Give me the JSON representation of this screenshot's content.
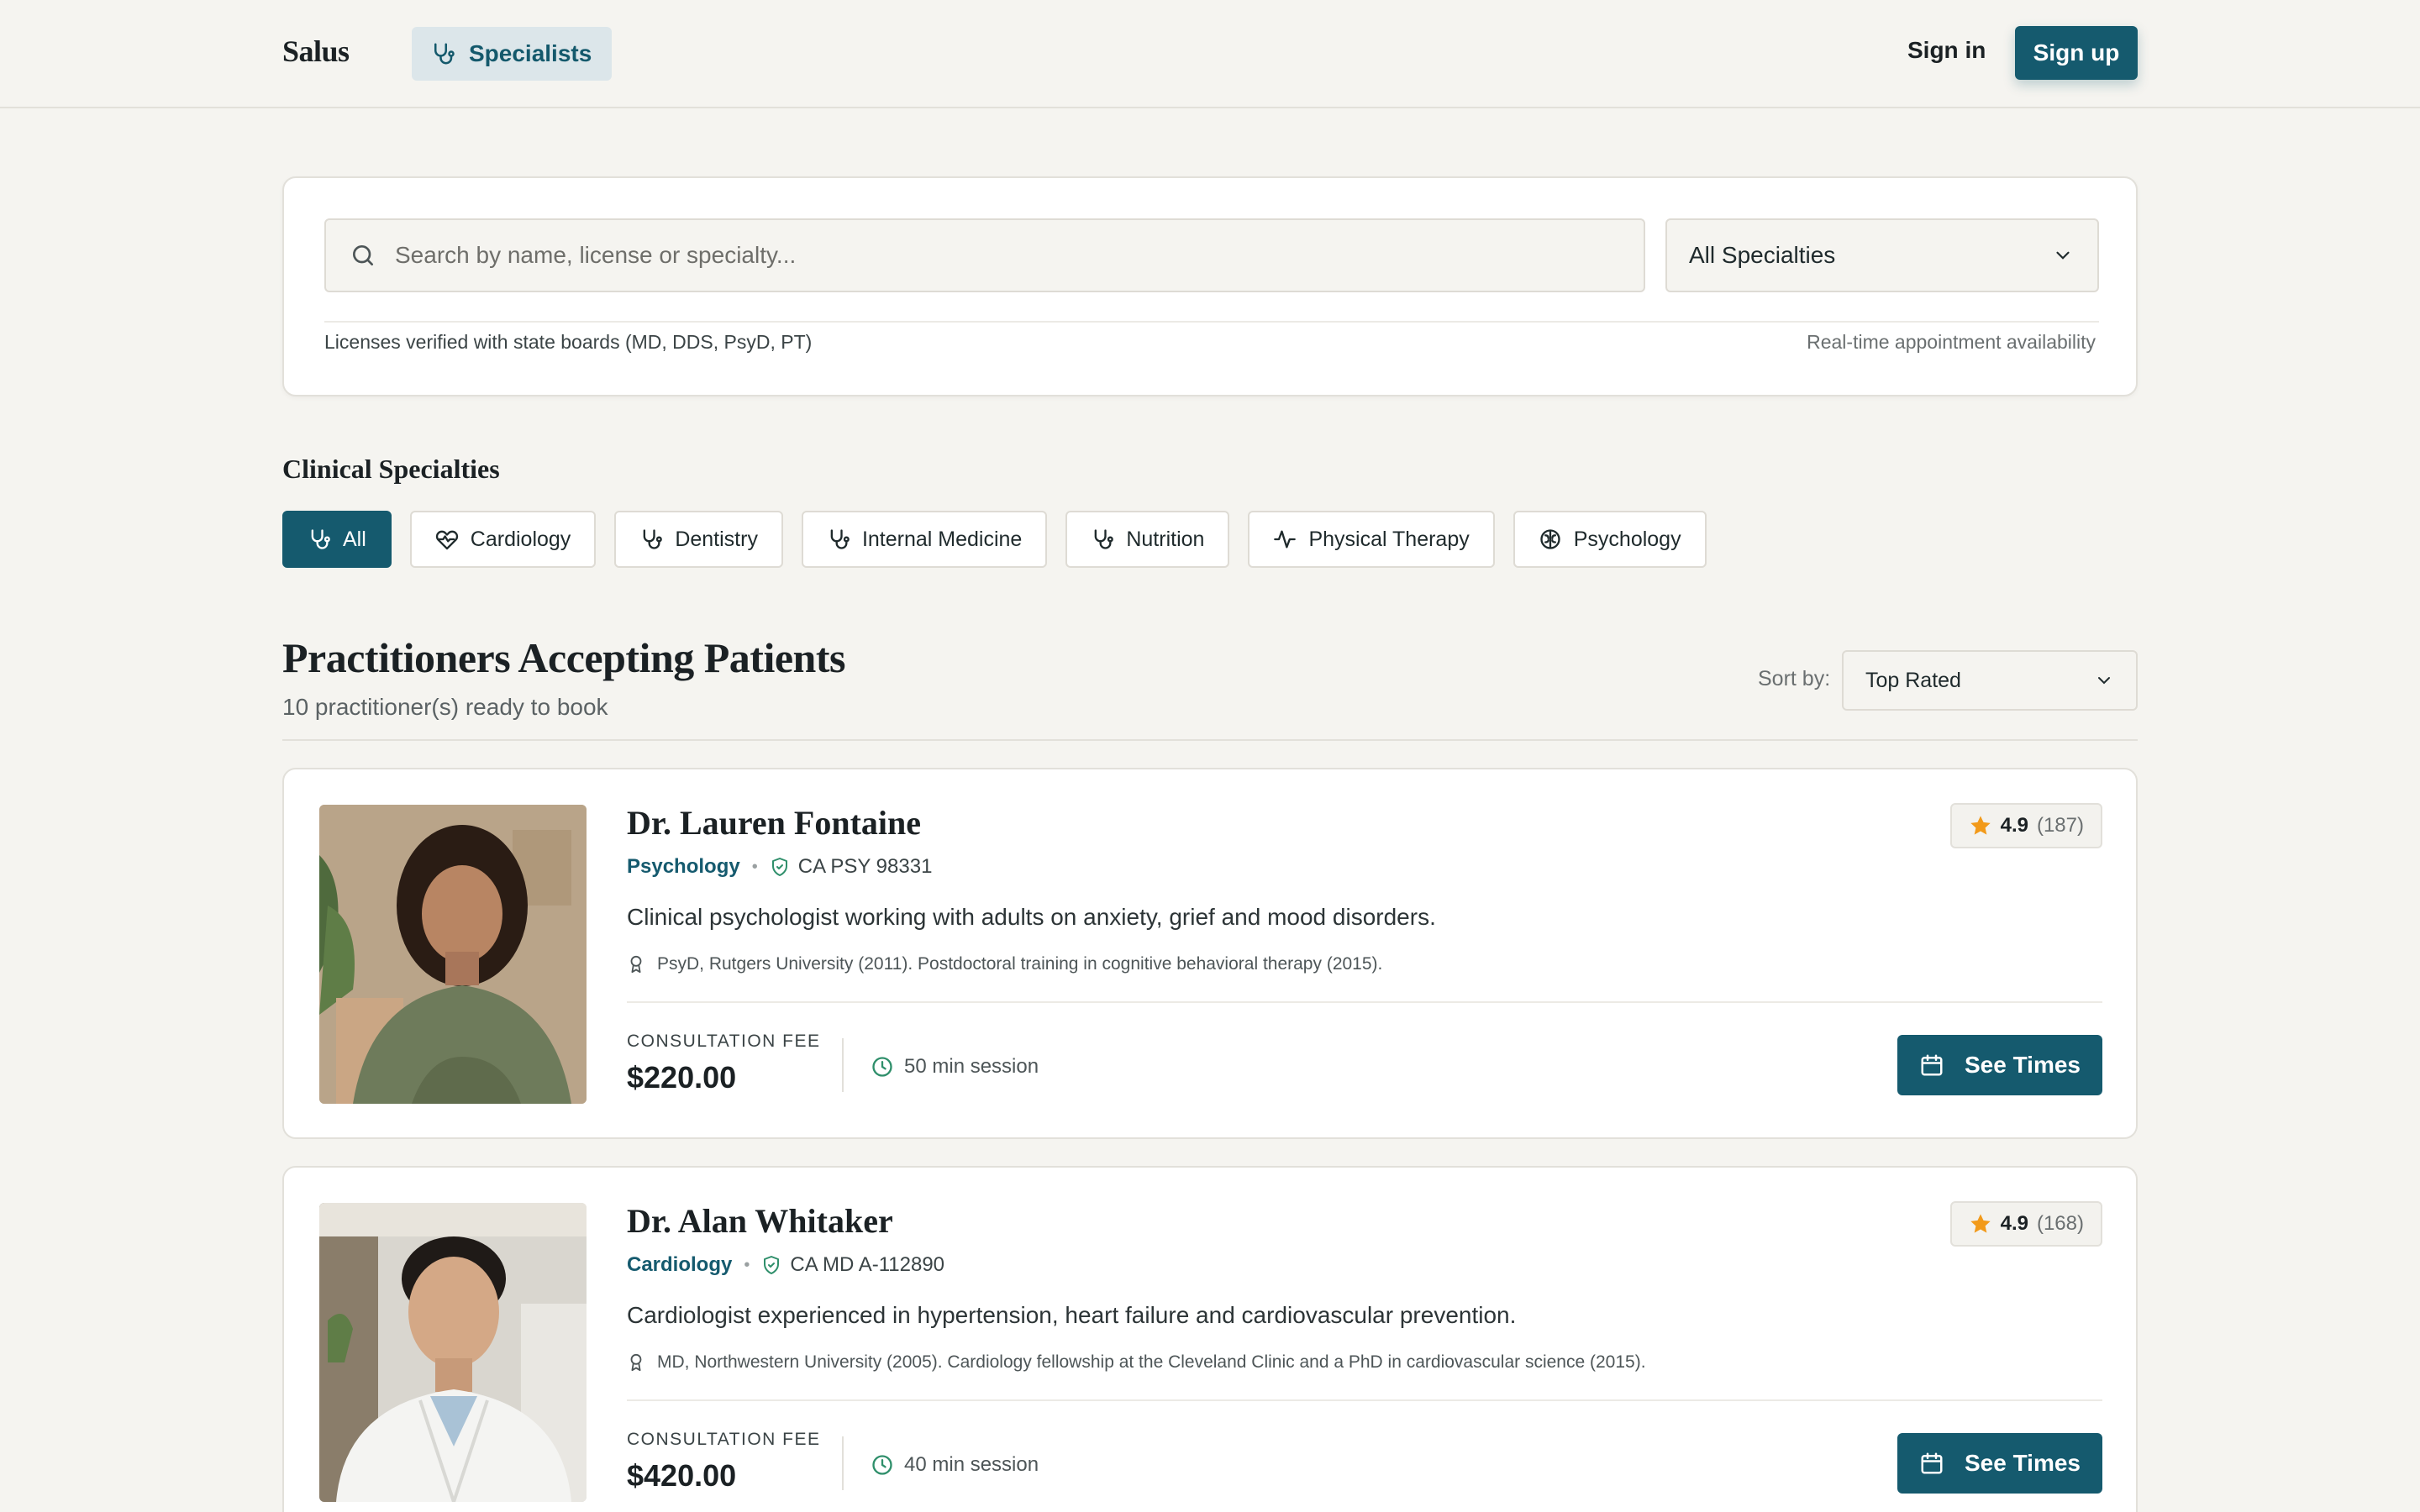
{
  "header": {
    "logo": "Salus",
    "nav_label": "Specialists",
    "signin_label": "Sign in",
    "signup_label": "Sign up"
  },
  "search": {
    "placeholder": "Search by name, license or specialty...",
    "specialty_selected": "All Specialties",
    "note_left": "Licenses verified with state boards (MD, DDS, PsyD, PT)",
    "note_right": "Real-time appointment availability"
  },
  "specialties": {
    "title": "Clinical Specialties",
    "chips": [
      {
        "label": "All",
        "icon": "stethoscope-icon",
        "active": true
      },
      {
        "label": "Cardiology",
        "icon": "heart-pulse-icon",
        "active": false
      },
      {
        "label": "Dentistry",
        "icon": "stethoscope-icon",
        "active": false
      },
      {
        "label": "Internal Medicine",
        "icon": "stethoscope-icon",
        "active": false
      },
      {
        "label": "Nutrition",
        "icon": "stethoscope-icon",
        "active": false
      },
      {
        "label": "Physical Therapy",
        "icon": "activity-icon",
        "active": false
      },
      {
        "label": "Psychology",
        "icon": "brain-icon",
        "active": false
      }
    ]
  },
  "results": {
    "title": "Practitioners Accepting Patients",
    "count_text": "10 practitioner(s) ready to book",
    "sort_label": "Sort by:",
    "sort_selected": "Top Rated"
  },
  "practitioners": [
    {
      "name": "Dr. Lauren Fontaine",
      "specialty": "Psychology",
      "license": "CA PSY 98331",
      "bio": "Clinical psychologist working with adults on anxiety, grief and mood disorders.",
      "education": "PsyD, Rutgers University (2011). Postdoctoral training in cognitive behavioral therapy (2015).",
      "fee_label": "CONSULTATION FEE",
      "fee": "$220.00",
      "session": "50 min session",
      "rating": "4.9",
      "reviews": "(187)",
      "cta": "See Times"
    },
    {
      "name": "Dr. Alan Whitaker",
      "specialty": "Cardiology",
      "license": "CA MD A-112890",
      "bio": "Cardiologist experienced in hypertension, heart failure and cardiovascular prevention.",
      "education": "MD, Northwestern University (2005). Cardiology fellowship at the Cleveland Clinic and a PhD in cardiovascular science (2015).",
      "fee_label": "CONSULTATION FEE",
      "fee": "$420.00",
      "session": "40 min session",
      "rating": "4.9",
      "reviews": "(168)",
      "cta": "See Times"
    }
  ],
  "colors": {
    "brand": "#155a6e",
    "background": "#f5f4f0",
    "star": "#f29a1a",
    "verified": "#2f8f6b"
  }
}
